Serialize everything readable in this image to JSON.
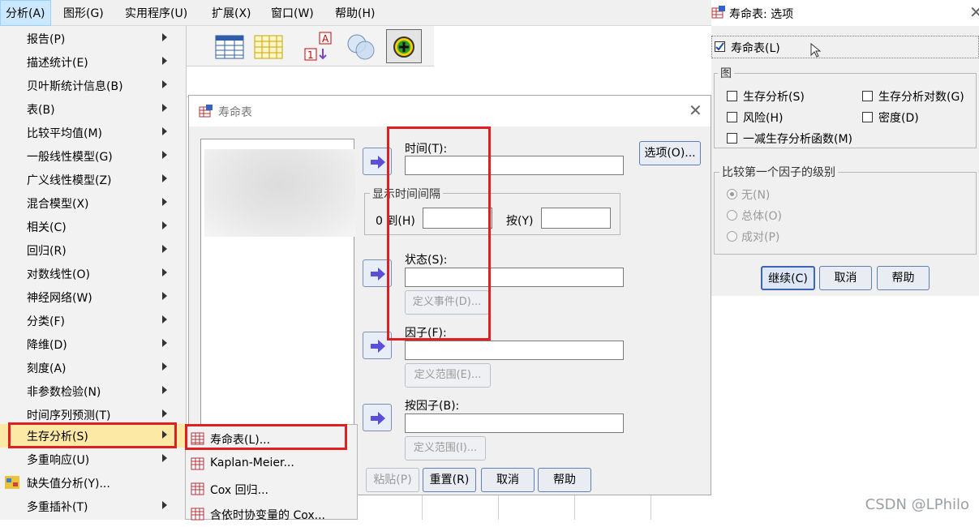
{
  "menubar": {
    "items": [
      "分析(A)",
      "图形(G)",
      "实用程序(U)",
      "扩展(X)",
      "窗口(W)",
      "帮助(H)"
    ]
  },
  "analyze_menu": {
    "items": [
      {
        "label": "报告(P)"
      },
      {
        "label": "描述统计(E)"
      },
      {
        "label": "贝叶斯统计信息(B)"
      },
      {
        "label": "表(B)"
      },
      {
        "label": "比较平均值(M)"
      },
      {
        "label": "一般线性模型(G)"
      },
      {
        "label": "广义线性模型(Z)"
      },
      {
        "label": "混合模型(X)"
      },
      {
        "label": "相关(C)"
      },
      {
        "label": "回归(R)"
      },
      {
        "label": "对数线性(O)"
      },
      {
        "label": "神经网络(W)"
      },
      {
        "label": "分类(F)"
      },
      {
        "label": "降维(D)"
      },
      {
        "label": "刻度(A)"
      },
      {
        "label": "非参数检验(N)"
      },
      {
        "label": "时间序列预测(T)"
      },
      {
        "label": "生存分析(S)"
      },
      {
        "label": "多重响应(U)"
      },
      {
        "label": "缺失值分析(Y)..."
      },
      {
        "label": "多重插补(T)"
      }
    ]
  },
  "survival_submenu": {
    "items": [
      "寿命表(L)...",
      "Kaplan-Meier...",
      "Cox 回归...",
      "含依时协变量的 Cox..."
    ]
  },
  "life_table_dialog": {
    "title": "寿命表",
    "options_button": "选项(O)...",
    "time_label": "时间(T):",
    "interval_group": "显示时间间隔",
    "from_label": "0 到(H)",
    "by_label": "按(Y)",
    "status_label": "状态(S):",
    "define_event_button": "定义事件(D)...",
    "factor_label": "因子(F):",
    "define_range_button": "定义范围(E)...",
    "by_factor_label": "按因子(B):",
    "define_range_button2": "定义范围(I)...",
    "paste_button": "粘贴(P)",
    "reset_button": "重置(R)",
    "cancel_button": "取消",
    "help_button": "帮助"
  },
  "options_dialog": {
    "title": "寿命表: 选项",
    "life_table_checkbox": "寿命表(L)",
    "life_table_checked": true,
    "plots_group": "图",
    "plots": {
      "survival": "生存分析(S)",
      "log_survival": "生存分析对数(G)",
      "hazard": "风险(H)",
      "density": "密度(D)",
      "one_minus_survival": "一减生存分析函数(M)"
    },
    "compare_group": "比较第一个因子的级别",
    "compare_options": [
      "无(N)",
      "总体(O)",
      "成对(P)"
    ],
    "compare_selected": "无(N)",
    "continue_button": "继续(C)",
    "cancel_button": "取消",
    "help_button": "帮助"
  },
  "watermark": "CSDN @LPhilo",
  "colors": {
    "highlight_red": "#e02020",
    "menu_selected": "#fde9a6",
    "menu_bg": "#f2f2f2",
    "dialog_bg": "#f0f0f0",
    "arrow_button": "#5b4fd6"
  }
}
